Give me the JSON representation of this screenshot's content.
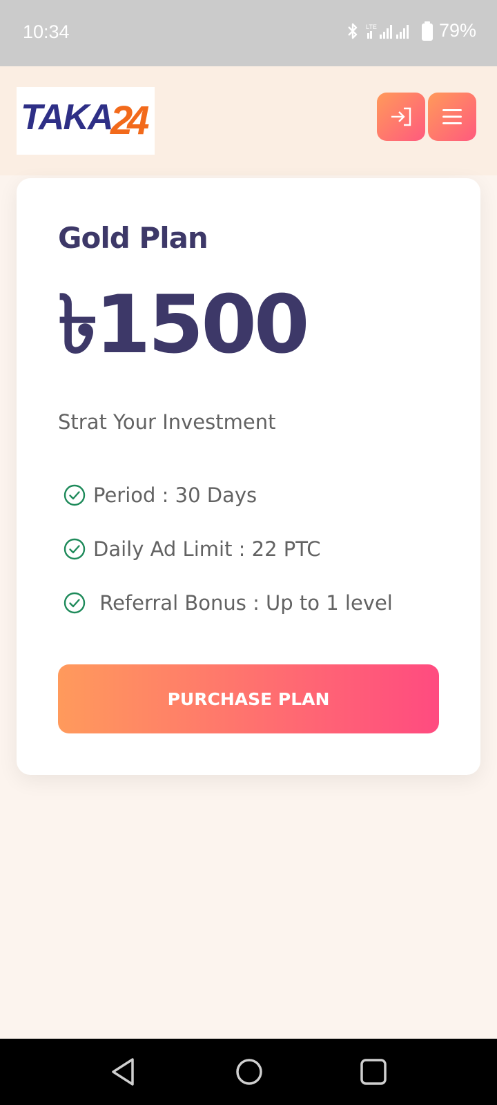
{
  "status_bar": {
    "time": "10:34",
    "battery_percent": "79%",
    "network": "LTE",
    "icons": [
      "bluetooth-icon",
      "signal-icon",
      "battery-icon"
    ]
  },
  "header": {
    "logo_text": "TAKA",
    "logo_number": "24",
    "login_icon": "login-icon",
    "menu_icon": "menu-icon"
  },
  "plan": {
    "title": "Gold Plan",
    "price": "৳1500",
    "subtitle": "Strat Your Investment",
    "features": [
      "Period : 30 Days",
      "Daily Ad Limit : 22 PTC",
      " Referral Bonus : Up to 1 level"
    ],
    "button_label": "PURCHASE PLAN"
  },
  "colors": {
    "brand_navy": "#3d3868",
    "accent_orange": "#ff9a5c",
    "accent_pink": "#ff4b80",
    "check_green": "#1e8a5a"
  },
  "nav": {
    "icons": [
      "back-icon",
      "home-icon",
      "recents-icon"
    ]
  }
}
